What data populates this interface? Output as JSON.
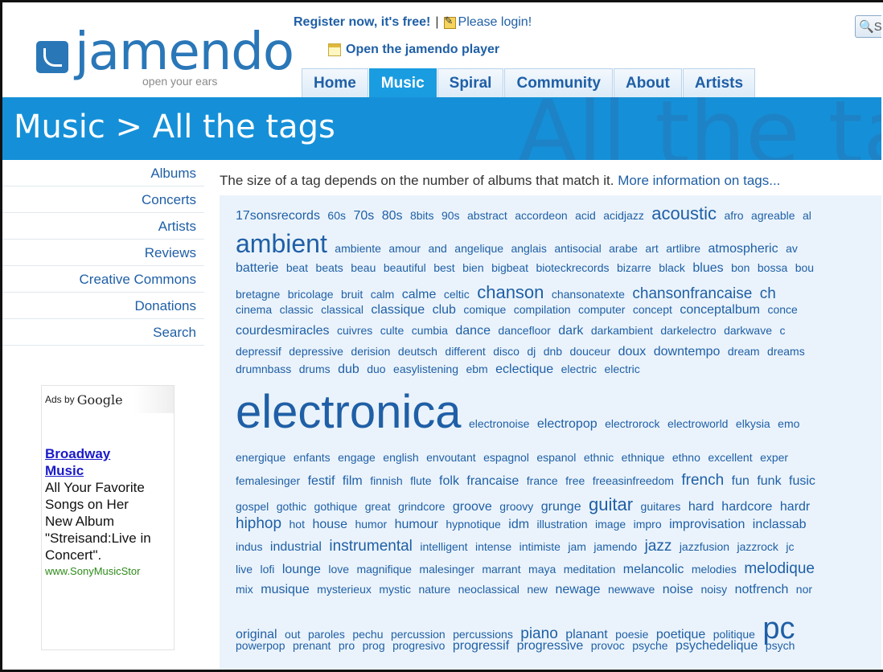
{
  "header": {
    "logo_text": "jamendo",
    "tagline": "open your ears",
    "register_label": "Register now, it's free!",
    "separator": "|",
    "login_label": "Please login!",
    "player_label": "Open the jamendo player",
    "search_partial": "S"
  },
  "nav": {
    "tabs": [
      {
        "label": "Home",
        "active": false
      },
      {
        "label": "Music",
        "active": true
      },
      {
        "label": "Spiral",
        "active": false
      },
      {
        "label": "Community",
        "active": false
      },
      {
        "label": "About",
        "active": false
      },
      {
        "label": "Artists",
        "active": false
      }
    ]
  },
  "banner": {
    "title": "Music > All the tags",
    "ghost_text": "All the tags"
  },
  "sidebar": {
    "items": [
      "Albums",
      "Concerts",
      "Artists",
      "Reviews",
      "Creative Commons",
      "Donations",
      "Search"
    ]
  },
  "ad": {
    "header_prefix": "Ads by",
    "header_brand": "Google",
    "title_line1": "Broadway",
    "title_line2": "Music",
    "body": [
      "All Your Favorite",
      "Songs on Her",
      "New Album",
      "\"Streisand:Live in",
      "Concert\"."
    ],
    "url": "www.SonyMusicStor"
  },
  "main": {
    "intro": "The size of a tag depends on the number of albums that match it.",
    "intro_link": "More information on tags..."
  },
  "tag_lines": [
    [
      [
        "17sonsrecords",
        "s2"
      ],
      [
        "60s",
        "s1"
      ],
      [
        "70s",
        "s2"
      ],
      [
        "80s",
        "s2"
      ],
      [
        "8bits",
        "s1"
      ],
      [
        "90s",
        "s1"
      ],
      [
        "abstract",
        "s1"
      ],
      [
        "accordeon",
        "s1"
      ],
      [
        "acid",
        "s1"
      ],
      [
        "acidjazz",
        "s1"
      ],
      [
        "acoustic",
        "s4"
      ],
      [
        "afro",
        "s1"
      ],
      [
        "agreable",
        "s1"
      ],
      [
        "al",
        "s1"
      ]
    ],
    [
      [
        "ambient",
        "s5"
      ],
      [
        "ambiente",
        "s1"
      ],
      [
        "amour",
        "s1"
      ],
      [
        "and",
        "s1"
      ],
      [
        "angelique",
        "s1"
      ],
      [
        "anglais",
        "s1"
      ],
      [
        "antisocial",
        "s1"
      ],
      [
        "arabe",
        "s1"
      ],
      [
        "art",
        "s1"
      ],
      [
        "artlibre",
        "s1"
      ],
      [
        "atmospheric",
        "s2"
      ],
      [
        "av",
        "s1"
      ]
    ],
    [
      [
        "batterie",
        "s2"
      ],
      [
        "beat",
        "s1"
      ],
      [
        "beats",
        "s1"
      ],
      [
        "beau",
        "s1"
      ],
      [
        "beautiful",
        "s1"
      ],
      [
        "best",
        "s1"
      ],
      [
        "bien",
        "s1"
      ],
      [
        "bigbeat",
        "s1"
      ],
      [
        "bioteckrecords",
        "s1"
      ],
      [
        "bizarre",
        "s1"
      ],
      [
        "black",
        "s1"
      ],
      [
        "blues",
        "s2"
      ],
      [
        "bon",
        "s1"
      ],
      [
        "bossa",
        "s1"
      ],
      [
        "bou",
        "s1"
      ]
    ],
    [
      [
        "bretagne",
        "s1"
      ],
      [
        "bricolage",
        "s1"
      ],
      [
        "bruit",
        "s1"
      ],
      [
        "calm",
        "s1"
      ],
      [
        "calme",
        "s2"
      ],
      [
        "celtic",
        "s1"
      ],
      [
        "chanson",
        "s4"
      ],
      [
        "chansonatexte",
        "s1"
      ],
      [
        "chansonfrancaise",
        "s3"
      ],
      [
        "ch",
        "s3"
      ]
    ],
    [
      [
        "cinema",
        "s1"
      ],
      [
        "classic",
        "s1"
      ],
      [
        "classical",
        "s1"
      ],
      [
        "classique",
        "s2"
      ],
      [
        "club",
        "s2"
      ],
      [
        "comique",
        "s1"
      ],
      [
        "compilation",
        "s1"
      ],
      [
        "computer",
        "s1"
      ],
      [
        "concept",
        "s1"
      ],
      [
        "conceptalbum",
        "s2"
      ],
      [
        "conce",
        "s1"
      ]
    ],
    [
      [
        "courdesmiracles",
        "s2"
      ],
      [
        "cuivres",
        "s1"
      ],
      [
        "culte",
        "s1"
      ],
      [
        "cumbia",
        "s1"
      ],
      [
        "dance",
        "s2"
      ],
      [
        "dancefloor",
        "s1"
      ],
      [
        "dark",
        "s2"
      ],
      [
        "darkambient",
        "s1"
      ],
      [
        "darkelectro",
        "s1"
      ],
      [
        "darkwave",
        "s1"
      ],
      [
        "c",
        "s1"
      ]
    ],
    [
      [
        "depressif",
        "s1"
      ],
      [
        "depressive",
        "s1"
      ],
      [
        "derision",
        "s1"
      ],
      [
        "deutsch",
        "s1"
      ],
      [
        "different",
        "s1"
      ],
      [
        "disco",
        "s1"
      ],
      [
        "dj",
        "s1"
      ],
      [
        "dnb",
        "s1"
      ],
      [
        "douceur",
        "s1"
      ],
      [
        "doux",
        "s2"
      ],
      [
        "downtempo",
        "s2"
      ],
      [
        "dream",
        "s1"
      ],
      [
        "dreams",
        "s1"
      ]
    ],
    [
      [
        "drumnbass",
        "s1"
      ],
      [
        "drums",
        "s1"
      ],
      [
        "dub",
        "s2"
      ],
      [
        "duo",
        "s1"
      ],
      [
        "easylistening",
        "s1"
      ],
      [
        "ebm",
        "s1"
      ],
      [
        "eclectique",
        "s2"
      ],
      [
        "electric",
        "s1"
      ],
      [
        "electric",
        "s1"
      ]
    ],
    [
      [
        "electronica",
        "s6"
      ],
      [
        "electronoise",
        "s1"
      ],
      [
        "electropop",
        "s2"
      ],
      [
        "electrorock",
        "s1"
      ],
      [
        "electroworld",
        "s1"
      ],
      [
        "elkysia",
        "s1"
      ],
      [
        "emo",
        "s1"
      ]
    ],
    [
      [
        "energique",
        "s1"
      ],
      [
        "enfants",
        "s1"
      ],
      [
        "engage",
        "s1"
      ],
      [
        "english",
        "s1"
      ],
      [
        "envoutant",
        "s1"
      ],
      [
        "espagnol",
        "s1"
      ],
      [
        "espanol",
        "s1"
      ],
      [
        "ethnic",
        "s1"
      ],
      [
        "ethnique",
        "s1"
      ],
      [
        "ethno",
        "s1"
      ],
      [
        "excellent",
        "s1"
      ],
      [
        "exper",
        "s1"
      ]
    ],
    [
      [
        "femalesinger",
        "s1"
      ],
      [
        "festif",
        "s2"
      ],
      [
        "film",
        "s2"
      ],
      [
        "finnish",
        "s1"
      ],
      [
        "flute",
        "s1"
      ],
      [
        "folk",
        "s2"
      ],
      [
        "francaise",
        "s2"
      ],
      [
        "france",
        "s1"
      ],
      [
        "free",
        "s1"
      ],
      [
        "freeasinfreedom",
        "s1"
      ],
      [
        "french",
        "s3"
      ],
      [
        "fun",
        "s2"
      ],
      [
        "funk",
        "s2"
      ],
      [
        "fusic",
        "s2"
      ]
    ],
    [
      [
        "gospel",
        "s1"
      ],
      [
        "gothic",
        "s1"
      ],
      [
        "gothique",
        "s1"
      ],
      [
        "great",
        "s1"
      ],
      [
        "grindcore",
        "s1"
      ],
      [
        "groove",
        "s2"
      ],
      [
        "groovy",
        "s1"
      ],
      [
        "grunge",
        "s2"
      ],
      [
        "guitar",
        "s4"
      ],
      [
        "guitares",
        "s1"
      ],
      [
        "hard",
        "s2"
      ],
      [
        "hardcore",
        "s2"
      ],
      [
        "hardr",
        "s2"
      ]
    ],
    [
      [
        "hiphop",
        "s3"
      ],
      [
        "hot",
        "s1"
      ],
      [
        "house",
        "s2"
      ],
      [
        "humor",
        "s1"
      ],
      [
        "humour",
        "s2"
      ],
      [
        "hypnotique",
        "s1"
      ],
      [
        "idm",
        "s2"
      ],
      [
        "illustration",
        "s1"
      ],
      [
        "image",
        "s1"
      ],
      [
        "impro",
        "s1"
      ],
      [
        "improvisation",
        "s2"
      ],
      [
        "inclassab",
        "s2"
      ]
    ],
    [
      [
        "indus",
        "s1"
      ],
      [
        "industrial",
        "s2"
      ],
      [
        "instrumental",
        "s3"
      ],
      [
        "intelligent",
        "s1"
      ],
      [
        "intense",
        "s1"
      ],
      [
        "intimiste",
        "s1"
      ],
      [
        "jam",
        "s1"
      ],
      [
        "jamendo",
        "s1"
      ],
      [
        "jazz",
        "s3"
      ],
      [
        "jazzfusion",
        "s1"
      ],
      [
        "jazzrock",
        "s1"
      ],
      [
        "jc",
        "s1"
      ]
    ],
    [
      [
        "live",
        "s1"
      ],
      [
        "lofi",
        "s1"
      ],
      [
        "lounge",
        "s2"
      ],
      [
        "love",
        "s1"
      ],
      [
        "magnifique",
        "s1"
      ],
      [
        "malesinger",
        "s1"
      ],
      [
        "marrant",
        "s1"
      ],
      [
        "maya",
        "s1"
      ],
      [
        "meditation",
        "s1"
      ],
      [
        "melancolic",
        "s2"
      ],
      [
        "melodies",
        "s1"
      ],
      [
        "melodique",
        "s3"
      ]
    ],
    [
      [
        "mix",
        "s1"
      ],
      [
        "musique",
        "s2"
      ],
      [
        "mysterieux",
        "s1"
      ],
      [
        "mystic",
        "s1"
      ],
      [
        "nature",
        "s1"
      ],
      [
        "neoclassical",
        "s1"
      ],
      [
        "new",
        "s1"
      ],
      [
        "newage",
        "s2"
      ],
      [
        "newwave",
        "s1"
      ],
      [
        "noise",
        "s2"
      ],
      [
        "noisy",
        "s1"
      ],
      [
        "notfrench",
        "s2"
      ],
      [
        "nor",
        "s1"
      ]
    ],
    [
      [
        "original",
        "s2"
      ],
      [
        "out",
        "s1"
      ],
      [
        "paroles",
        "s1"
      ],
      [
        "pechu",
        "s1"
      ],
      [
        "percussion",
        "s1"
      ],
      [
        "percussions",
        "s1"
      ],
      [
        "piano",
        "s3"
      ],
      [
        "planant",
        "s2"
      ],
      [
        "poesie",
        "s1"
      ],
      [
        "poetique",
        "s2"
      ],
      [
        "politique",
        "s1"
      ],
      [
        "pc",
        "s5b"
      ]
    ],
    [
      [
        "powerpop",
        "s1"
      ],
      [
        "prenant",
        "s1"
      ],
      [
        "pro",
        "s1"
      ],
      [
        "prog",
        "s1"
      ],
      [
        "progresivo",
        "s1"
      ],
      [
        "progressif",
        "s2"
      ],
      [
        "progressive",
        "s2"
      ],
      [
        "provoc",
        "s1"
      ],
      [
        "psyche",
        "s1"
      ],
      [
        "psychedelique",
        "s2"
      ],
      [
        "psych",
        "s1"
      ]
    ]
  ]
}
